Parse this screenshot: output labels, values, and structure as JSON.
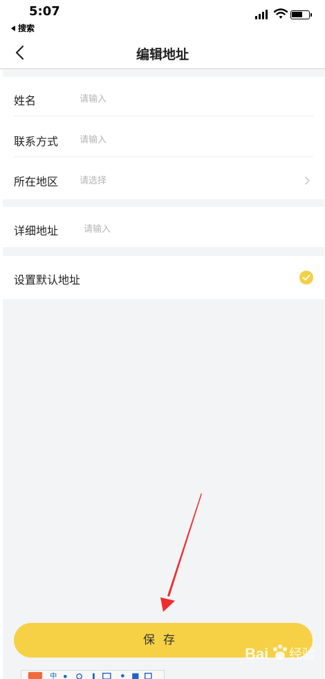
{
  "status_bar": {
    "time": "5:07",
    "back_app": "搜索"
  },
  "nav": {
    "title": "编辑地址",
    "back_icon": "chevron-left-icon"
  },
  "form": {
    "name": {
      "label": "姓名",
      "placeholder": "请输入"
    },
    "contact": {
      "label": "联系方式",
      "placeholder": "请输入"
    },
    "region": {
      "label": "所在地区",
      "placeholder": "请选择"
    },
    "detail": {
      "label": "详细地址",
      "placeholder": "请输入"
    },
    "default": {
      "label": "设置默认地址",
      "checked": true
    }
  },
  "save_label": "保存",
  "watermark": {
    "brand": "Bai",
    "text": "经验"
  },
  "colors": {
    "accent": "#f6d145",
    "check": "#f3cf45",
    "page_bg": "#f3f4f6",
    "arrow": "#f02d2d"
  }
}
